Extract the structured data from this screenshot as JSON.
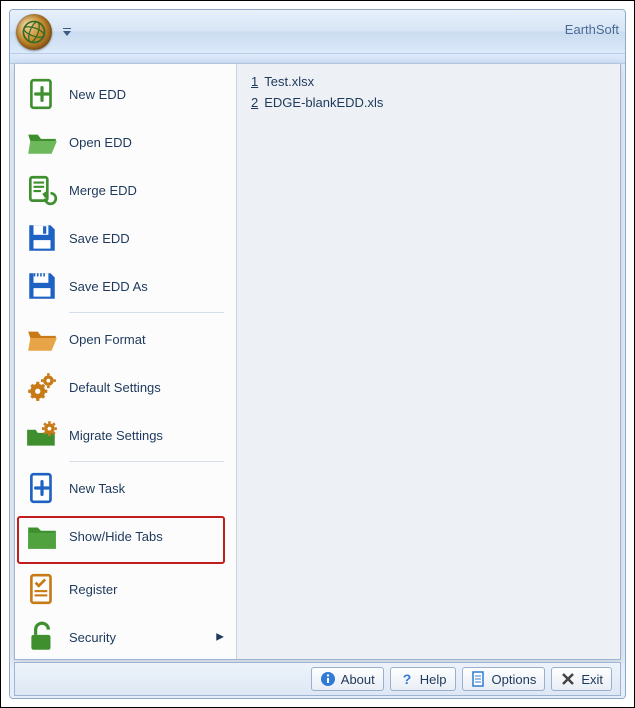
{
  "app_title": "EarthSoft",
  "menu": {
    "items": [
      {
        "label": "New EDD"
      },
      {
        "label": "Open EDD"
      },
      {
        "label": "Merge EDD"
      },
      {
        "label": "Save EDD"
      },
      {
        "label": "Save EDD As"
      },
      {
        "label": "Open Format"
      },
      {
        "label": "Default Settings"
      },
      {
        "label": "Migrate Settings"
      },
      {
        "label": "New Task"
      },
      {
        "label": "Show/Hide Tabs"
      },
      {
        "label": "Register"
      },
      {
        "label": "Security"
      }
    ]
  },
  "recent": [
    {
      "num": "1",
      "name": "Test.xlsx"
    },
    {
      "num": "2",
      "name": "EDGE-blankEDD.xls"
    }
  ],
  "footer": {
    "about": "About",
    "help": "Help",
    "options": "Options",
    "exit": "Exit"
  },
  "colors": {
    "green": "#3f8f2f",
    "orange": "#c87a17",
    "blue": "#1e62c4"
  }
}
